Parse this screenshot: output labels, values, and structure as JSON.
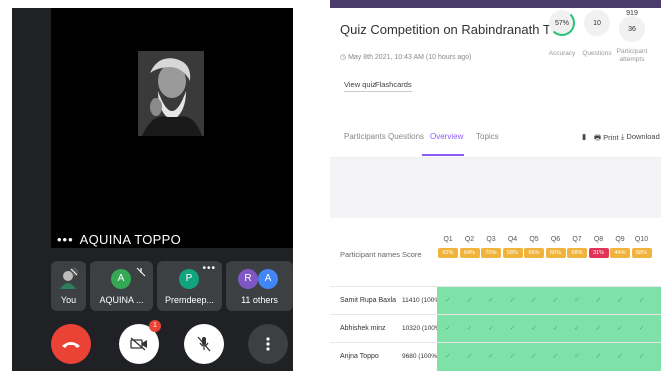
{
  "call": {
    "stage_name": "AQUINA TOPPO",
    "tiles": [
      {
        "label": "You",
        "avatar": ""
      },
      {
        "label": "AQUINA ...",
        "avatar": "A",
        "color": "#34a853"
      },
      {
        "label": "Premdeep...",
        "avatar": "P",
        "color": "#12a37f"
      },
      {
        "label": "11 others",
        "avatars": [
          "R",
          "A"
        ],
        "colors": [
          "#7e57c2",
          "#4285f4"
        ]
      }
    ],
    "camera_badge": "1"
  },
  "quiz": {
    "title": "Quiz Competition on Rabindranath Tagore - Dept. of Eng",
    "date": "May 8th 2021, 10:43 AM (10 hours ago)",
    "view_quiz": "View quiz",
    "flashcards": "Flashcards",
    "stats": [
      {
        "value": "57%",
        "label": "Accuracy"
      },
      {
        "value": "10",
        "label": "Questions"
      },
      {
        "value": "36",
        "top": "919",
        "label": "Participant attempts"
      }
    ],
    "tabs": [
      "Participants",
      "Questions",
      "Overview",
      "Topics"
    ],
    "actions": {
      "print": "Print",
      "download": "Download"
    },
    "table": {
      "names_header": "Participant names",
      "score_header": "Score",
      "questions": [
        {
          "q": "Q1",
          "pct": "62%",
          "color": "#f0b43c"
        },
        {
          "q": "Q2",
          "pct": "64%",
          "color": "#f0b43c"
        },
        {
          "q": "Q3",
          "pct": "70%",
          "color": "#f0b43c"
        },
        {
          "q": "Q4",
          "pct": "58%",
          "color": "#f0b43c"
        },
        {
          "q": "Q5",
          "pct": "66%",
          "color": "#f0b43c"
        },
        {
          "q": "Q6",
          "pct": "60%",
          "color": "#f0b43c"
        },
        {
          "q": "Q7",
          "pct": "68%",
          "color": "#f0b43c"
        },
        {
          "q": "Q8",
          "pct": "31%",
          "color": "#e0345a"
        },
        {
          "q": "Q9",
          "pct": "44%",
          "color": "#f0b43c"
        },
        {
          "q": "Q10",
          "pct": "58%",
          "color": "#f0b43c"
        }
      ],
      "rows": [
        {
          "name": "Samit Rupa Baxla",
          "score": "11410 (100%)"
        },
        {
          "name": "Abhishek minz",
          "score": "10320 (100%)"
        },
        {
          "name": "Anjna Toppo",
          "score": "9680 (100%)"
        }
      ],
      "check": "✓"
    }
  }
}
